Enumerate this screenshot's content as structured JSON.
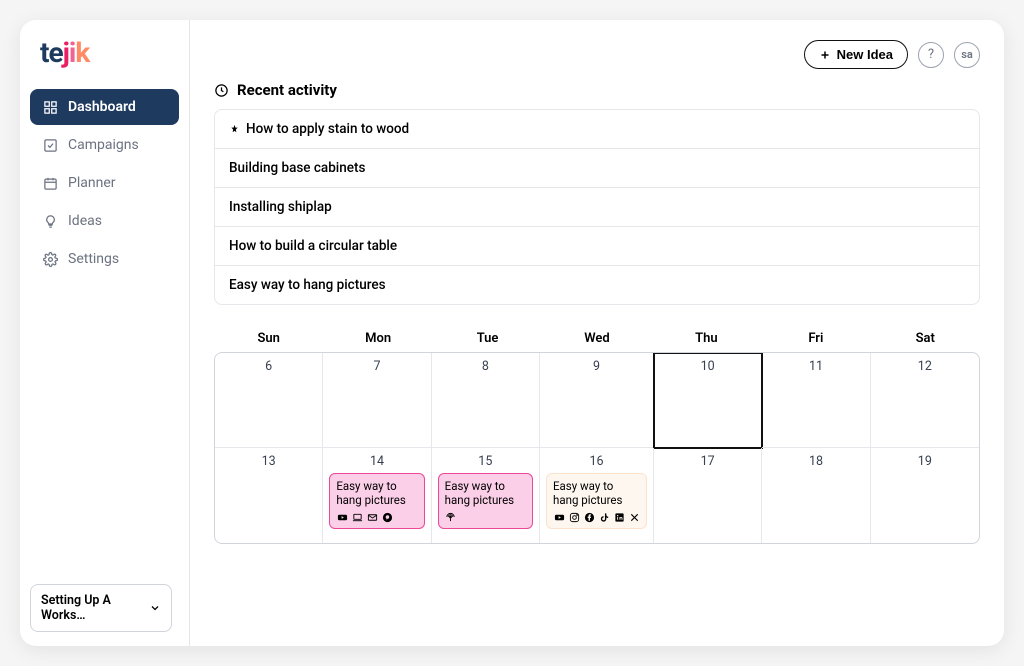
{
  "logo": "tejik",
  "sidebar": {
    "items": [
      {
        "label": "Dashboard",
        "icon": "grid"
      },
      {
        "label": "Campaigns",
        "icon": "check-square"
      },
      {
        "label": "Planner",
        "icon": "calendar"
      },
      {
        "label": "Ideas",
        "icon": "bulb"
      },
      {
        "label": "Settings",
        "icon": "gear"
      }
    ]
  },
  "bottom_widget": {
    "label": "Setting Up A Works…"
  },
  "topbar": {
    "new_idea_label": "New Idea",
    "avatar_initials": "sa"
  },
  "recent_activity": {
    "title": "Recent activity",
    "items": [
      {
        "label": "How to apply stain to wood",
        "pinned": true
      },
      {
        "label": "Building base cabinets",
        "pinned": false
      },
      {
        "label": "Installing shiplap",
        "pinned": false
      },
      {
        "label": "How to build a circular table",
        "pinned": false
      },
      {
        "label": "Easy way to hang pictures",
        "pinned": false
      }
    ]
  },
  "calendar": {
    "day_headers": [
      "Sun",
      "Mon",
      "Tue",
      "Wed",
      "Thu",
      "Fri",
      "Sat"
    ],
    "weeks": [
      {
        "days": [
          {
            "date": "6"
          },
          {
            "date": "7"
          },
          {
            "date": "8"
          },
          {
            "date": "9"
          },
          {
            "date": "10",
            "today": true
          },
          {
            "date": "11"
          },
          {
            "date": "12"
          }
        ]
      },
      {
        "days": [
          {
            "date": "13"
          },
          {
            "date": "14",
            "event": {
              "title": "Easy way to hang pictures",
              "variant": "pink",
              "icons": [
                "youtube",
                "laptop",
                "mail",
                "pinterest"
              ]
            }
          },
          {
            "date": "15",
            "event": {
              "title": "Easy way to hang pictures",
              "variant": "pink",
              "icons": [
                "podcast"
              ]
            }
          },
          {
            "date": "16",
            "event": {
              "title": "Easy way to hang pictures",
              "variant": "light",
              "icons": [
                "youtube",
                "instagram",
                "facebook",
                "tiktok",
                "linkedin",
                "x"
              ]
            }
          },
          {
            "date": "17"
          },
          {
            "date": "18"
          },
          {
            "date": "19"
          }
        ]
      }
    ]
  }
}
